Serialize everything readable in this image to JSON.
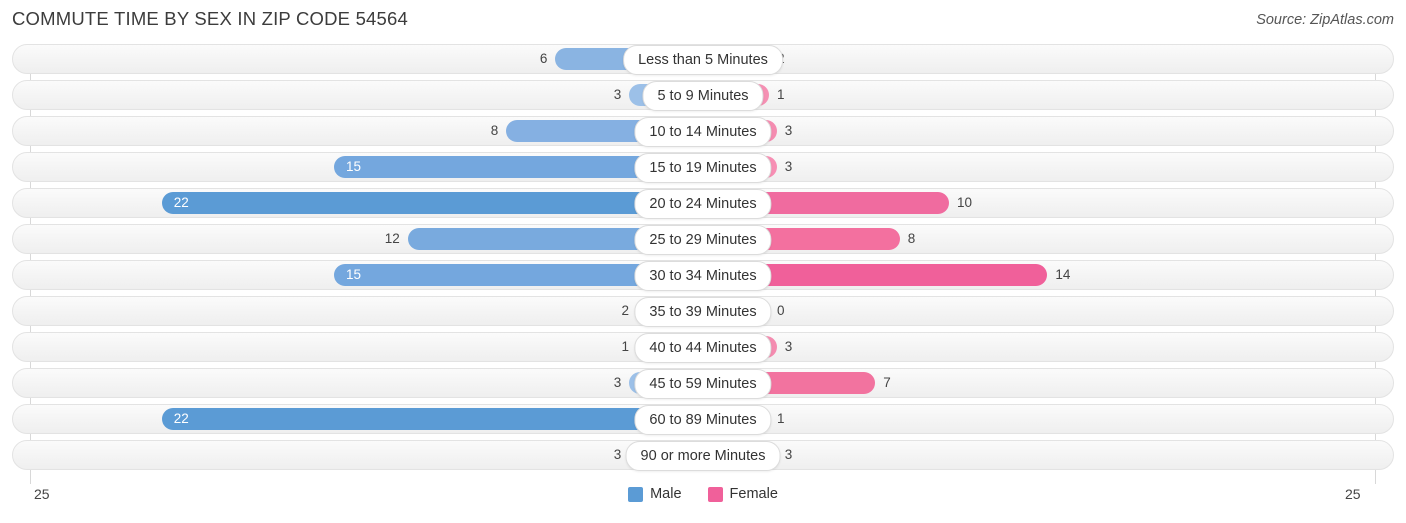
{
  "header": {
    "title": "COMMUTE TIME BY SEX IN ZIP CODE 54564",
    "source": "Source: ZipAtlas.com"
  },
  "footer": {
    "axis_left": "25",
    "axis_right": "25",
    "legend": [
      {
        "label": "Male",
        "color": "#5b9bd5"
      },
      {
        "label": "Female",
        "color": "#f0609a"
      }
    ]
  },
  "chart_data": {
    "type": "bar",
    "orientation": "horizontal-diverging",
    "title": "COMMUTE TIME BY SEX IN ZIP CODE 54564",
    "xlabel": "",
    "ylabel": "",
    "axis_max": 25,
    "axis_min": 25,
    "xlim": [
      -25,
      25
    ],
    "grid": true,
    "legend_position": "bottom-center",
    "categories": [
      "Less than 5 Minutes",
      "5 to 9 Minutes",
      "10 to 14 Minutes",
      "15 to 19 Minutes",
      "20 to 24 Minutes",
      "25 to 29 Minutes",
      "30 to 34 Minutes",
      "35 to 39 Minutes",
      "40 to 44 Minutes",
      "45 to 59 Minutes",
      "60 to 89 Minutes",
      "90 or more Minutes"
    ],
    "series": [
      {
        "name": "Male",
        "color": "#5b9bd5",
        "values": [
          6,
          3,
          8,
          15,
          22,
          12,
          15,
          2,
          1,
          3,
          22,
          3
        ]
      },
      {
        "name": "Female",
        "color": "#f0609a",
        "values": [
          2,
          1,
          3,
          3,
          10,
          8,
          14,
          0,
          3,
          7,
          1,
          3
        ]
      }
    ]
  },
  "rows": [
    {
      "label": "Less than 5 Minutes",
      "male": 6,
      "female": 2,
      "male_text": "6",
      "female_text": "2",
      "male_color": "#8ab4e2",
      "female_color": "#f492b4",
      "male_inside": false,
      "female_inside": false
    },
    {
      "label": "5 to 9 Minutes",
      "male": 3,
      "female": 1,
      "male_text": "3",
      "female_text": "1",
      "male_color": "#9cc0e8",
      "female_color": "#f590b3",
      "male_inside": false,
      "female_inside": false
    },
    {
      "label": "10 to 14 Minutes",
      "male": 8,
      "female": 3,
      "male_text": "8",
      "female_text": "3",
      "male_color": "#85b0e2",
      "female_color": "#f48cb0",
      "male_inside": false,
      "female_inside": false
    },
    {
      "label": "15 to 19 Minutes",
      "male": 15,
      "female": 3,
      "male_text": "15",
      "female_text": "3",
      "male_color": "#74a7de",
      "female_color": "#f78fb4",
      "male_inside": true,
      "female_inside": false
    },
    {
      "label": "20 to 24 Minutes",
      "male": 22,
      "female": 10,
      "male_text": "22",
      "female_text": "10",
      "male_color": "#5b9bd5",
      "female_color": "#f06b9f",
      "male_inside": true,
      "female_inside": false
    },
    {
      "label": "25 to 29 Minutes",
      "male": 12,
      "female": 8,
      "male_text": "12",
      "female_text": "8",
      "male_color": "#79aade",
      "female_color": "#f3709f",
      "male_inside": false,
      "female_inside": false
    },
    {
      "label": "30 to 34 Minutes",
      "male": 15,
      "female": 14,
      "male_text": "15",
      "female_text": "14",
      "male_color": "#74a7de",
      "female_color": "#f0609a",
      "male_inside": true,
      "female_inside": false
    },
    {
      "label": "35 to 39 Minutes",
      "male": 2,
      "female": 0,
      "male_text": "2",
      "female_text": "0",
      "male_color": "#a5c6ec",
      "female_color": "#f9a8c6",
      "male_inside": false,
      "female_inside": false
    },
    {
      "label": "40 to 44 Minutes",
      "male": 1,
      "female": 3,
      "male_text": "1",
      "female_text": "3",
      "male_color": "#a8c8ed",
      "female_color": "#f48cb0",
      "male_inside": false,
      "female_inside": false
    },
    {
      "label": "45 to 59 Minutes",
      "male": 3,
      "female": 7,
      "male_text": "3",
      "female_text": "7",
      "male_color": "#9cc0e8",
      "female_color": "#f2739f",
      "male_inside": false,
      "female_inside": false
    },
    {
      "label": "60 to 89 Minutes",
      "male": 22,
      "female": 1,
      "male_text": "22",
      "female_text": "1",
      "male_color": "#5b9bd5",
      "female_color": "#f590b3",
      "male_inside": true,
      "female_inside": false
    },
    {
      "label": "90 or more Minutes",
      "male": 3,
      "female": 3,
      "male_text": "3",
      "female_text": "3",
      "male_color": "#a2c4eb",
      "female_color": "#f48cb0",
      "male_inside": false,
      "female_inside": false
    }
  ]
}
